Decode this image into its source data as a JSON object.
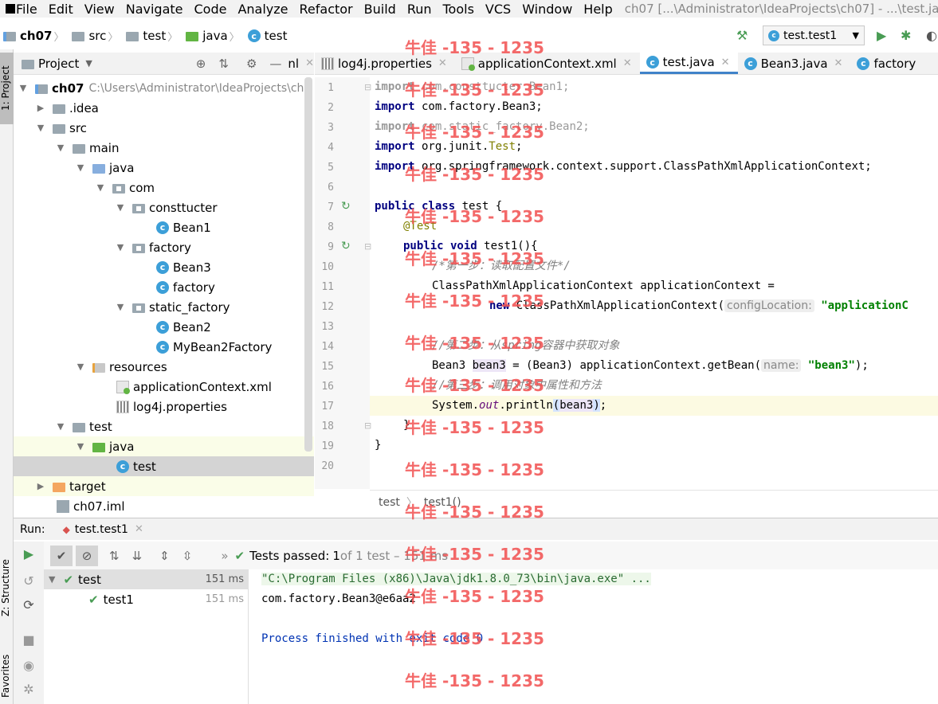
{
  "menu": {
    "items": [
      "File",
      "Edit",
      "View",
      "Navigate",
      "Code",
      "Analyze",
      "Refactor",
      "Build",
      "Run",
      "Tools",
      "VCS",
      "Window",
      "Help"
    ],
    "window_title": "ch07 [...\\Administrator\\IdeaProjects\\ch07] - ...\\test.java"
  },
  "breadcrumbs": [
    "ch07",
    "src",
    "test",
    "java",
    "test"
  ],
  "run_config": "test.test1",
  "project_panel": {
    "title": "Project",
    "right_partial": "nl"
  },
  "tree": [
    {
      "label": "ch07",
      "path": "C:\\Users\\Administrator\\IdeaProjects\\ch"
    },
    {
      "label": ".idea"
    },
    {
      "label": "src"
    },
    {
      "label": "main"
    },
    {
      "label": "java"
    },
    {
      "label": "com"
    },
    {
      "label": "consttucter"
    },
    {
      "label": "Bean1"
    },
    {
      "label": "factory"
    },
    {
      "label": "Bean3"
    },
    {
      "label": "factory"
    },
    {
      "label": "static_factory"
    },
    {
      "label": "Bean2"
    },
    {
      "label": "MyBean2Factory"
    },
    {
      "label": "resources"
    },
    {
      "label": "applicationContext.xml"
    },
    {
      "label": "log4j.properties"
    },
    {
      "label": "test"
    },
    {
      "label": "java"
    },
    {
      "label": "test"
    },
    {
      "label": "target"
    },
    {
      "label": "ch07.iml"
    }
  ],
  "tabs": [
    "log4j.properties",
    "applicationContext.xml",
    "test.java",
    "Bean3.java",
    "factory"
  ],
  "line_numbers": [
    "1",
    "2",
    "3",
    "4",
    "5",
    "6",
    "7",
    "8",
    "9",
    "10",
    "11",
    "12",
    "13",
    "14",
    "15",
    "16",
    "17",
    "18",
    "19",
    "20"
  ],
  "code": {
    "l1a": "import",
    "l1b": " com.consttucter.Bean1;",
    "l2a": "import",
    "l2b": " com.factory.Bean3;",
    "l3a": "import",
    "l3b": " com.static_factory.Bean2;",
    "l4a": "import",
    "l4b": " org.junit.",
    "l4c": "Test",
    ";": ";",
    "l5a": "import",
    "l5b": " org.springframework.context.support.ClassPathXmlApplicationContext;",
    "l7a": "public",
    "l7b": " class",
    "l7c": " test {",
    "l8": "@Test",
    "l9a": "public",
    "l9b": " void",
    "l9c": " test1(){",
    "l10": "/*第一步：读取配置文件*/",
    "l11": "ClassPathXmlApplicationContext applicationContext =",
    "l12a": "new",
    "l12b": " ClassPathXmlApplicationContext(",
    "l12hint": "configLocation:",
    "l12str": " \"applicationC",
    "l14": "//第二步：从spring容器中获取对象",
    "l15a": "Bean3 ",
    "l15b": "bean3",
    "l15c": " = (Bean3) applicationContext.getBean(",
    "l15hint": "name:",
    "l15str": " \"bean3\"",
    "l15d": ");",
    "l16": "//第三步：调用对象中属性和方法",
    "l17a": "System.",
    "l17b": "out",
    "l17c": ".println",
    "l17d": "(",
    "l17e": "bean3",
    "l17f": ")",
    ";17": ";",
    "l18": "}",
    "l19": "}"
  },
  "editor_crumb": {
    "a": "test",
    "b": "test1()"
  },
  "run": {
    "label": "Run:",
    "tab": "test.test1",
    "status_prefix": "Tests passed:",
    "status_count": "1",
    "status_rest": " of 1 test – 151 ms",
    "tree": [
      {
        "label": "test",
        "ms": "151 ms"
      },
      {
        "label": "test1",
        "ms": "151 ms"
      }
    ],
    "console": [
      "\"C:\\Program Files (x86)\\Java\\jdk1.8.0_73\\bin\\java.exe\" ...",
      "com.factory.Bean3@e6aa2",
      "",
      "Process finished with exit code 0"
    ]
  },
  "side_tabs": {
    "project": "1: Project",
    "structure": "Z: Structure",
    "favorites": "Favorites"
  },
  "watermark": "牛佳 -135 - 1235"
}
